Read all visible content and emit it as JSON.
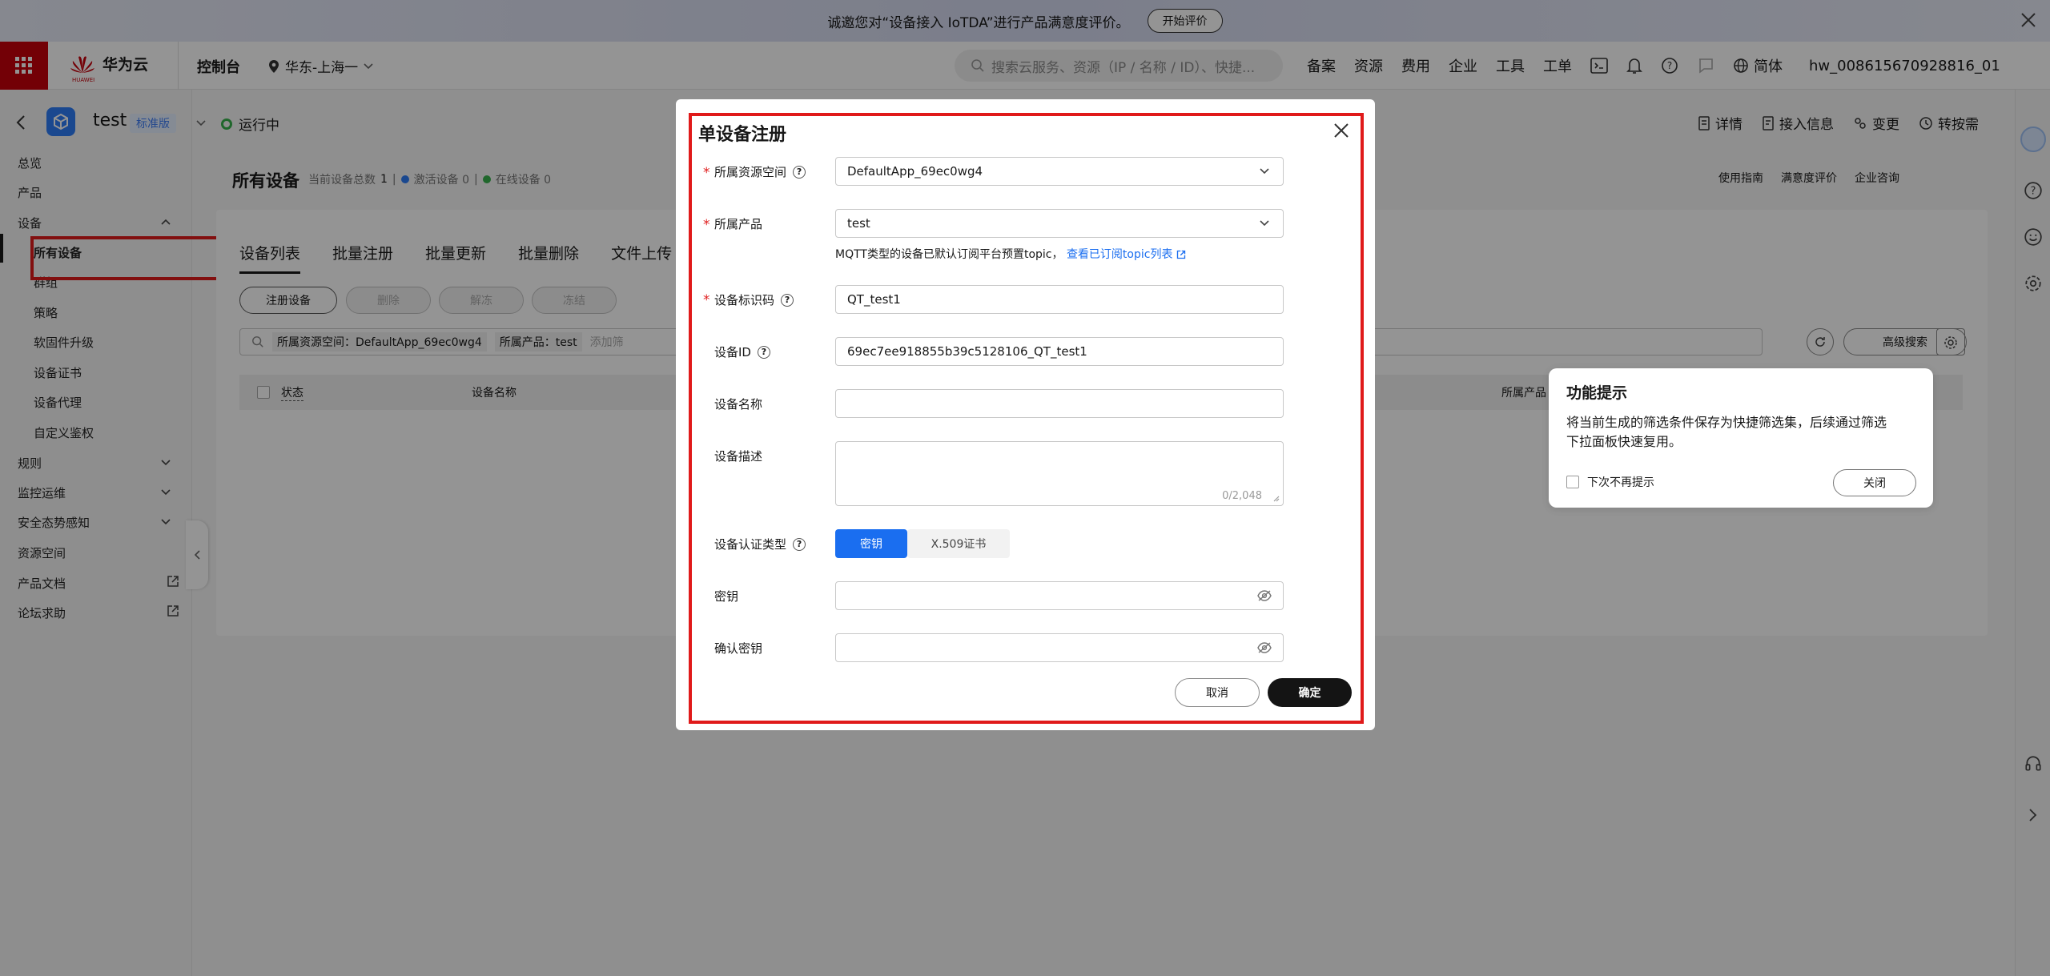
{
  "banner": {
    "text": "诚邀您对“设备接入 IoTDA”进行产品满意度评价。",
    "button": "开始评价"
  },
  "topnav": {
    "brand": "华为云",
    "brand_sub": "HUAWEI",
    "console": "控制台",
    "region": "华东-上海一",
    "search_placeholder": "搜索云服务、资源（IP / 名称 / ID）、快捷...",
    "menu": [
      "备案",
      "资源",
      "费用",
      "企业",
      "工具",
      "工单"
    ],
    "lang": "简体",
    "user": "hw_008615670928816_01"
  },
  "instance": {
    "name": "test",
    "edition": "标准版",
    "status": "运行中",
    "actions": [
      "详情",
      "接入信息",
      "变更",
      "转按需"
    ]
  },
  "sidebar": {
    "items": [
      "总览",
      "产品",
      "设备",
      "所有设备",
      "群组",
      "策略",
      "软固件升级",
      "设备证书",
      "设备代理",
      "自定义鉴权",
      "规则",
      "监控运维",
      "安全态势感知",
      "资源空间",
      "产品文档",
      "论坛求助"
    ]
  },
  "page": {
    "title": "所有设备",
    "stats": {
      "total_label": "当前设备总数",
      "total": "1",
      "active": "激活设备 0",
      "online": "在线设备 0"
    },
    "links": [
      "使用指南",
      "满意度评价",
      "企业咨询"
    ],
    "tabs": [
      "设备列表",
      "批量注册",
      "批量更新",
      "批量删除",
      "文件上传"
    ],
    "buttons": [
      "注册设备",
      "删除",
      "解冻",
      "冻结"
    ],
    "filters": [
      "所属资源空间：DefaultApp_69ec0wg4",
      "所属产品：test"
    ],
    "filter_placeholder": "添加筛",
    "advanced_search": "高级搜索",
    "columns": [
      "状态",
      "设备名称",
      "所属产品"
    ]
  },
  "dialog": {
    "title": "单设备注册",
    "fields": {
      "space_label": "所属资源空间",
      "space_value": "DefaultApp_69ec0wg4",
      "product_label": "所属产品",
      "product_value": "test",
      "hint": "MQTT类型的设备已默认订阅平台预置topic，",
      "hint_link": "查看已订阅topic列表",
      "code_label": "设备标识码",
      "code_value": "QT_test1",
      "id_label": "设备ID",
      "id_value": "69ec7ee918855b39c5128106_QT_test1",
      "name_label": "设备名称",
      "name_value": "",
      "desc_label": "设备描述",
      "desc_counter": "0/2,048",
      "auth_label": "设备认证类型",
      "auth_options": [
        "密钥",
        "X.509证书"
      ],
      "secret_label": "密钥",
      "confirm_label": "确认密钥"
    },
    "cancel": "取消",
    "ok": "确定"
  },
  "tip": {
    "title": "功能提示",
    "body_line1": "将当前生成的筛选条件保存为快捷筛选集，后续通过筛选",
    "body_line2": "下拉面板快速复用。",
    "checkbox": "下次不再提示",
    "close": "关闭"
  },
  "colors": {
    "brand_red": "#c7000b",
    "accent_blue": "#1a6ef0",
    "annotation_red": "#e01a1a"
  }
}
